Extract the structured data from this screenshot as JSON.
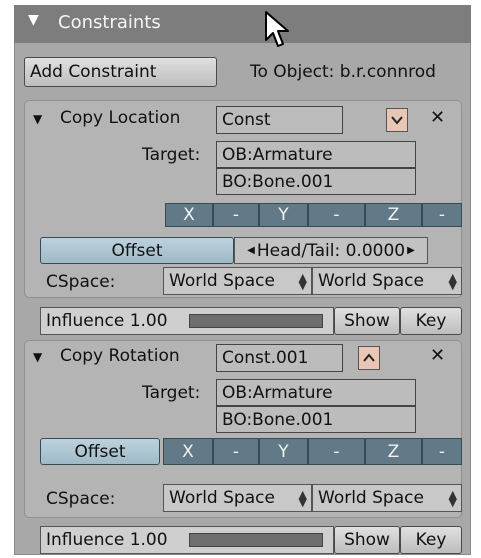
{
  "header": {
    "title": "Constraints",
    "toggle_icon": "triangle-down-icon"
  },
  "toolbar": {
    "add_constraint": "Add Constraint",
    "to_object": "To Object: b.r.connrod"
  },
  "copy_location": {
    "type_label": "Copy Location",
    "name": "Const",
    "target_label": "Target:",
    "target_object": "OB:Armature",
    "target_bone": "BO:Bone.001",
    "axes": [
      "X",
      "-",
      "Y",
      "-",
      "Z",
      "-"
    ],
    "offset_label": "Offset",
    "head_tail": "Head/Tail: 0.0000",
    "cspace_label": "CSpace:",
    "cspace_owner": "World Space",
    "cspace_target": "World Space",
    "influence": "Influence 1.00",
    "influence_value": 1.0,
    "show_label": "Show",
    "key_label": "Key"
  },
  "copy_rotation": {
    "type_label": "Copy Rotation",
    "name": "Const.001",
    "target_label": "Target:",
    "target_object": "OB:Armature",
    "target_bone": "BO:Bone.001",
    "offset_label": "Offset",
    "axes": [
      "X",
      "-",
      "Y",
      "-",
      "Z",
      "-"
    ],
    "cspace_label": "CSpace:",
    "cspace_owner": "World Space",
    "cspace_target": "World Space",
    "influence": "Influence 1.00",
    "influence_value": 1.0,
    "show_label": "Show",
    "key_label": "Key"
  }
}
